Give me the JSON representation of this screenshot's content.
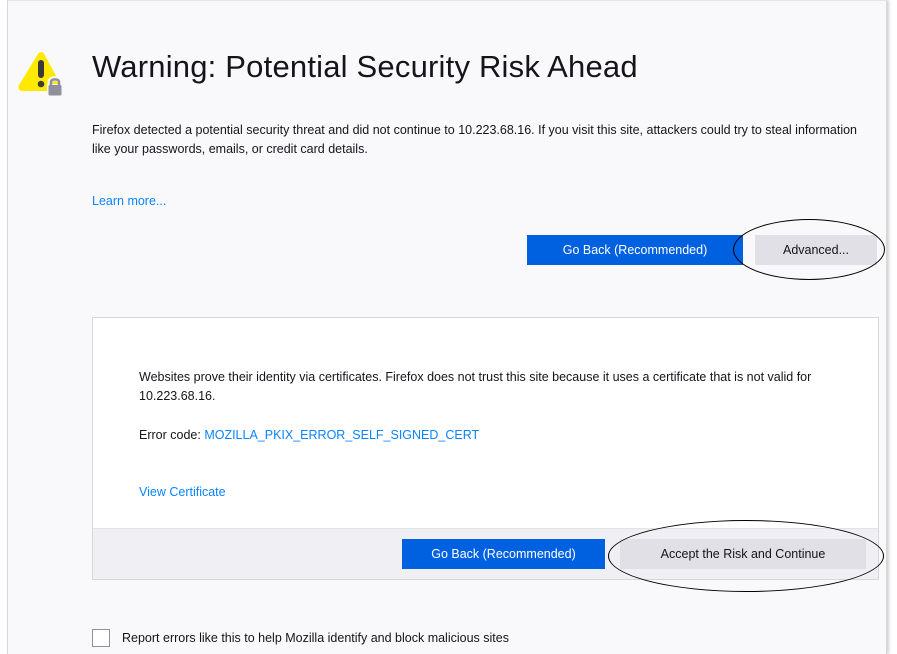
{
  "error_page": {
    "title": "Warning: Potential Security Risk Ahead",
    "intro": "Firefox detected a potential security threat and did not continue to 10.223.68.16. If you visit this site, attackers could try to steal information like your passwords, emails, or credit card details.",
    "learn_more": "Learn more...",
    "go_back_label": "Go Back (Recommended)",
    "advanced_label": "Advanced..."
  },
  "advanced_panel": {
    "description": "Websites prove their identity via certificates. Firefox does not trust this site because it uses a certificate that is not valid for 10.223.68.16.",
    "error_code_prefix": "Error code: ",
    "error_code": "MOZILLA_PKIX_ERROR_SELF_SIGNED_CERT",
    "view_certificate": "View Certificate",
    "go_back_label": "Go Back (Recommended)",
    "accept_label": "Accept the Risk and Continue"
  },
  "report": {
    "label": "Report errors like this to help Mozilla identify and block malicious sites",
    "checked": false
  },
  "colors": {
    "primary_button": "#0061e0",
    "link": "#0a84ff",
    "warning_yellow": "#ffe900",
    "lock_gray": "#8f8f9d"
  },
  "icons": {
    "warning": "warning-lock-icon"
  }
}
